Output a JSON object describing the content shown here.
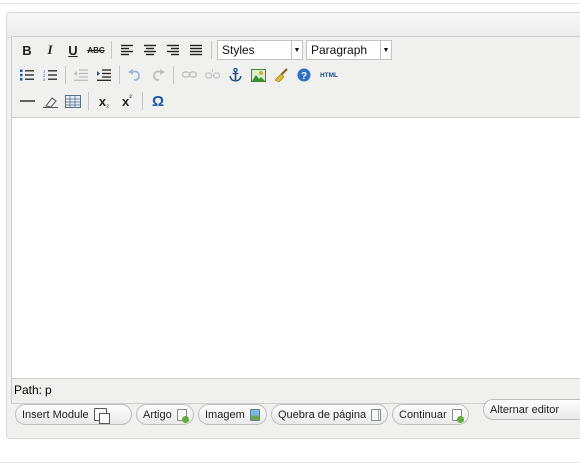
{
  "toolbar": {
    "styles_value": "Styles",
    "format_value": "Paragraph",
    "bold_label": "B",
    "italic_label": "I",
    "underline_label": "U",
    "strike_label": "ABC",
    "html_label": "HTML",
    "subscript_label": "x",
    "superscript_label": "x",
    "omega_label": "Ω"
  },
  "statusbar": {
    "path_label": "Path:",
    "path_value": "p"
  },
  "buttons": {
    "insert_module": "Insert Module",
    "artigo": "Artigo",
    "imagem": "Imagem",
    "quebra": "Quebra de página",
    "continuar": "Continuar",
    "alternar": "Alternar editor"
  },
  "colors": {
    "accent_link": "#1c5aa6",
    "panel_bg": "#f0f0ee"
  }
}
